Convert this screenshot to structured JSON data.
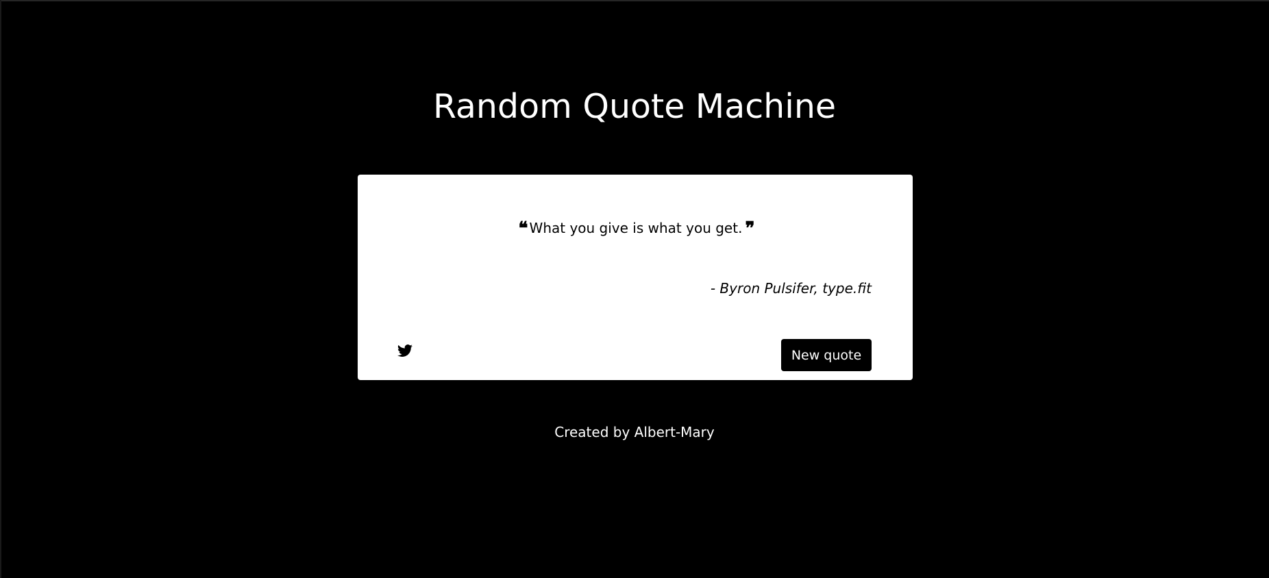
{
  "header": {
    "title": "Random Quote Machine"
  },
  "quote_box": {
    "open_mark": "❝",
    "text": "What you give is what you get.",
    "close_mark": "❞",
    "author": "- Byron Pulsifer, type.fit",
    "tweet_icon": "twitter-icon",
    "new_quote_label": "New quote"
  },
  "footer": {
    "credit": "Created by Albert-Mary"
  },
  "colors": {
    "background": "#000000",
    "card": "#ffffff",
    "button": "#000000",
    "text_light": "#ffffff",
    "text_dark": "#000000"
  }
}
